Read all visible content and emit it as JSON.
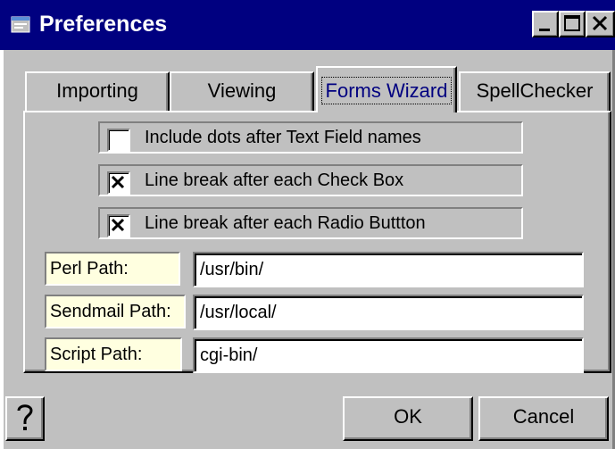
{
  "window": {
    "title": "Preferences",
    "buttons": {
      "minimize": "minimize-icon",
      "maximize": "maximize-icon",
      "close": "close-icon"
    }
  },
  "tabs": [
    {
      "label": "Importing",
      "active": false
    },
    {
      "label": "Viewing",
      "active": false
    },
    {
      "label": "Forms Wizard",
      "active": true
    },
    {
      "label": "SpellChecker",
      "active": false
    }
  ],
  "options": [
    {
      "label": "Include dots after Text Field names",
      "checked": false
    },
    {
      "label": "Line break after each Check Box",
      "checked": true
    },
    {
      "label": "Line break after each Radio Buttton",
      "checked": true
    }
  ],
  "paths": [
    {
      "label": "Perl Path:",
      "value": "/usr/bin/"
    },
    {
      "label": "Sendmail Path:",
      "value": "/usr/local/"
    },
    {
      "label": "Script Path:",
      "value": "cgi-bin/"
    }
  ],
  "buttons": {
    "help_icon": "question-mark-icon",
    "ok": "OK",
    "cancel": "Cancel"
  },
  "colors": {
    "title_bar": "#000080",
    "face": "#c0c0c0",
    "active_tab_text": "#000080",
    "label_background": "#ffffe0"
  }
}
